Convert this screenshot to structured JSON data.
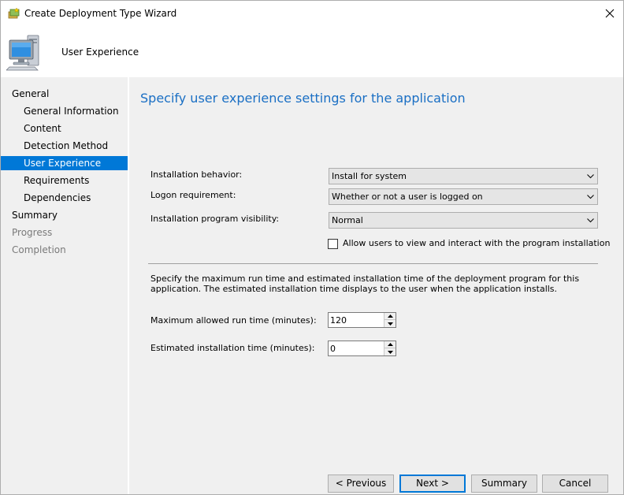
{
  "window": {
    "title": "Create Deployment Type Wizard",
    "close_symbol": "✕"
  },
  "header": {
    "title": "User Experience",
    "icon": "computer-icon"
  },
  "nav": {
    "items": [
      {
        "label": "General",
        "level": 0,
        "state": "normal"
      },
      {
        "label": "General Information",
        "level": 1,
        "state": "normal"
      },
      {
        "label": "Content",
        "level": 1,
        "state": "normal"
      },
      {
        "label": "Detection Method",
        "level": 1,
        "state": "normal"
      },
      {
        "label": "User Experience",
        "level": 1,
        "state": "selected"
      },
      {
        "label": "Requirements",
        "level": 1,
        "state": "normal"
      },
      {
        "label": "Dependencies",
        "level": 1,
        "state": "normal"
      },
      {
        "label": "Summary",
        "level": 0,
        "state": "normal"
      },
      {
        "label": "Progress",
        "level": 0,
        "state": "disabled"
      },
      {
        "label": "Completion",
        "level": 0,
        "state": "disabled"
      }
    ]
  },
  "content": {
    "title": "Specify user experience settings for the application",
    "installation_behavior": {
      "label": "Installation behavior:",
      "value": "Install for system"
    },
    "logon_requirement": {
      "label": "Logon requirement:",
      "value": "Whether or not a user is logged on"
    },
    "program_visibility": {
      "label": "Installation program visibility:",
      "value": "Normal"
    },
    "allow_interact": {
      "label": "Allow users to view and interact with the program installation",
      "checked": false
    },
    "description": "Specify the maximum run time and estimated installation time of the deployment program for this application. The estimated installation time displays to the user when the application installs.",
    "max_run_time": {
      "label": "Maximum allowed run time (minutes):",
      "value": "120"
    },
    "est_install_time": {
      "label": "Estimated installation time (minutes):",
      "value": "0"
    }
  },
  "buttons": {
    "previous": "< Previous",
    "next": "Next >",
    "summary": "Summary",
    "cancel": "Cancel"
  },
  "colors": {
    "accent": "#0078d7",
    "title_blue": "#1a6fc4",
    "pane_bg": "#f0f0f0"
  }
}
